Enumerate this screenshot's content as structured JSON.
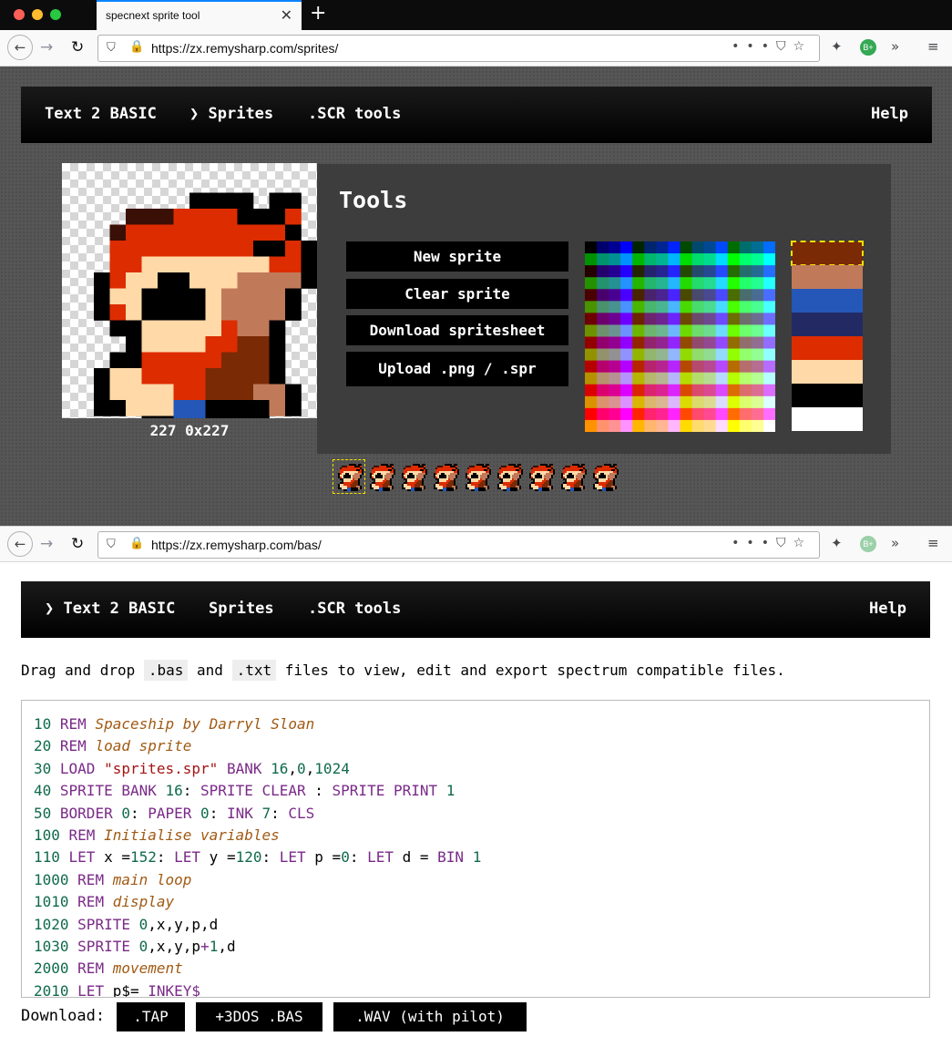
{
  "browser": {
    "tab_title": "specnext sprite tool",
    "tab_close": "✕",
    "new_tab": "+",
    "url_top": "https://zx.remysharp.com/sprites/",
    "url_bottom": "https://zx.remysharp.com/bas/"
  },
  "nav": {
    "items": [
      "Text 2 BASIC",
      "Sprites",
      ".SCR tools"
    ],
    "help": "Help",
    "active_marker": "❯"
  },
  "sprites_page": {
    "coords": "227 0x227",
    "tools_title": "Tools",
    "buttons": [
      "New sprite",
      "Clear sprite",
      "Download spritesheet",
      "Upload .png / .spr"
    ],
    "swatch_colors": [
      "#7a2a05",
      "#c07a5a",
      "#2457b8",
      "#232a63",
      "#dd2c00",
      "#ffd9a8",
      "#000000",
      "#ffffff"
    ],
    "selected_swatch": 0,
    "frame_count": 9,
    "selected_frame": 0
  },
  "bas_page": {
    "intro_parts": [
      "Drag and drop ",
      ".bas",
      " and ",
      ".txt",
      " files to view, edit and export spectrum compatible files."
    ],
    "download_label": "Download:",
    "download_buttons": [
      ".TAP",
      "+3DOS .BAS",
      ".WAV (with pilot)"
    ],
    "code_lines": [
      [
        [
          "ln",
          "10 "
        ],
        [
          "kw",
          "REM "
        ],
        [
          "cm",
          "Spaceship by Darryl Sloan"
        ]
      ],
      [
        [
          "ln",
          "20 "
        ],
        [
          "kw",
          "REM "
        ],
        [
          "cm",
          "load sprite"
        ]
      ],
      [
        [
          "ln",
          "30 "
        ],
        [
          "kw",
          "LOAD "
        ],
        [
          "st",
          "\"sprites.spr\""
        ],
        [
          "kw",
          " BANK "
        ],
        [
          "nm",
          "16"
        ],
        [
          "tx",
          ","
        ],
        [
          "nm",
          "0"
        ],
        [
          "tx",
          ","
        ],
        [
          "nm",
          "1024"
        ]
      ],
      [
        [
          "ln",
          "40 "
        ],
        [
          "kw",
          "SPRITE BANK "
        ],
        [
          "nm",
          "16"
        ],
        [
          "tx",
          ": "
        ],
        [
          "kw",
          "SPRITE CLEAR "
        ],
        [
          "tx",
          ": "
        ],
        [
          "kw",
          "SPRITE PRINT "
        ],
        [
          "nm",
          "1"
        ]
      ],
      [
        [
          "ln",
          "50 "
        ],
        [
          "kw",
          "BORDER "
        ],
        [
          "nm",
          "0"
        ],
        [
          "tx",
          ": "
        ],
        [
          "kw",
          "PAPER "
        ],
        [
          "nm",
          "0"
        ],
        [
          "tx",
          ": "
        ],
        [
          "kw",
          "INK "
        ],
        [
          "nm",
          "7"
        ],
        [
          "tx",
          ": "
        ],
        [
          "kw",
          "CLS"
        ]
      ],
      [
        [
          "ln",
          "100 "
        ],
        [
          "kw",
          "REM "
        ],
        [
          "cm",
          "Initialise variables"
        ]
      ],
      [
        [
          "ln",
          "110 "
        ],
        [
          "kw",
          "LET "
        ],
        [
          "tx",
          "x ="
        ],
        [
          "nm",
          "152"
        ],
        [
          "tx",
          ": "
        ],
        [
          "kw",
          "LET "
        ],
        [
          "tx",
          "y ="
        ],
        [
          "nm",
          "120"
        ],
        [
          "tx",
          ": "
        ],
        [
          "kw",
          "LET "
        ],
        [
          "tx",
          "p ="
        ],
        [
          "nm",
          "0"
        ],
        [
          "tx",
          ": "
        ],
        [
          "kw",
          "LET "
        ],
        [
          "tx",
          "d = "
        ],
        [
          "kw",
          "BIN "
        ],
        [
          "nm",
          "1"
        ]
      ],
      [
        [
          "ln",
          "1000 "
        ],
        [
          "kw",
          "REM "
        ],
        [
          "cm",
          "main loop"
        ]
      ],
      [
        [
          "ln",
          "1010 "
        ],
        [
          "kw",
          "REM "
        ],
        [
          "cm",
          "display"
        ]
      ],
      [
        [
          "ln",
          "1020 "
        ],
        [
          "kw",
          "SPRITE "
        ],
        [
          "nm",
          "0"
        ],
        [
          "tx",
          ",x,y,p,d"
        ]
      ],
      [
        [
          "ln",
          "1030 "
        ],
        [
          "kw",
          "SPRITE "
        ],
        [
          "nm",
          "0"
        ],
        [
          "tx",
          ",x,y,p"
        ],
        [
          "kw",
          "+"
        ],
        [
          "nm",
          "1"
        ],
        [
          "tx",
          ",d"
        ]
      ],
      [
        [
          "ln",
          "2000 "
        ],
        [
          "kw",
          "REM "
        ],
        [
          "cm",
          "movement"
        ]
      ],
      [
        [
          "ln",
          "2010 "
        ],
        [
          "kw",
          "LET "
        ],
        [
          "tx",
          "p$= "
        ],
        [
          "kw",
          "INKEY$"
        ]
      ]
    ]
  }
}
